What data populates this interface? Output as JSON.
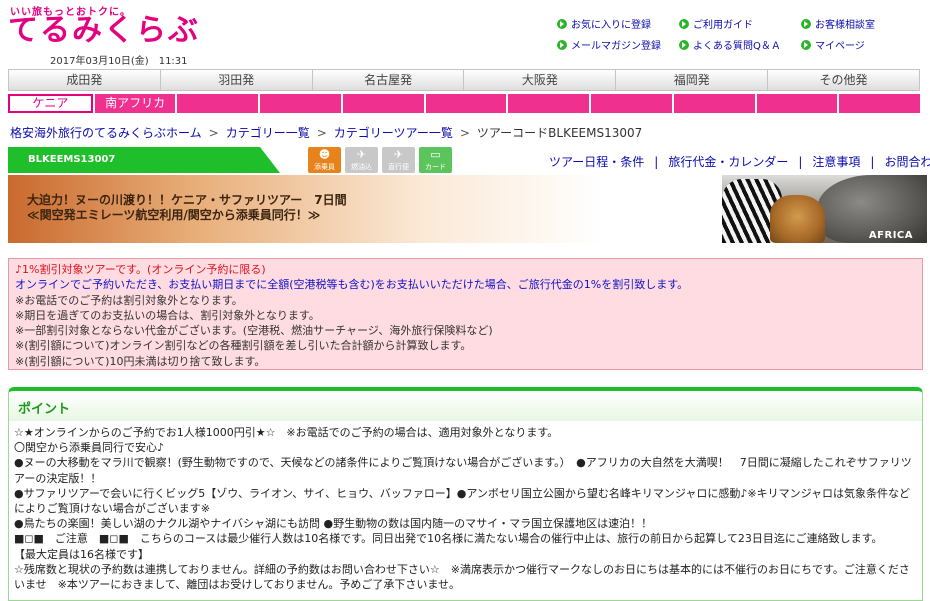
{
  "logo": {
    "tagline": "いい旅もっとおトクに。",
    "name": "てるみくらぶ",
    "datetime": "2017年03月10日(金)　11:31"
  },
  "header_links": [
    {
      "label": "お気に入りに登録"
    },
    {
      "label": "ご利用ガイド"
    },
    {
      "label": "お客様相談室"
    },
    {
      "label": "メールマガジン登録"
    },
    {
      "label": "よくある質問Q＆Ａ"
    },
    {
      "label": "マイページ"
    }
  ],
  "departure_nav": [
    "成田発",
    "羽田発",
    "名古屋発",
    "大阪発",
    "福岡発",
    "その他発"
  ],
  "country_tabs": [
    "ケニア",
    "南アフリカ",
    "",
    "",
    "",
    "",
    "",
    "",
    "",
    "",
    ""
  ],
  "breadcrumb": [
    "格安海外旅行のてるみくらぶホーム",
    "カテゴリー一覧",
    "カテゴリーツアー一覧",
    "ツアーコードBLKEEMS13007"
  ],
  "tour": {
    "code": "BLKEEMS13007",
    "icons": [
      {
        "label": "添乗員",
        "icon": "tour-guide-icon"
      },
      {
        "label": "燃油込",
        "icon": "fuel-included-icon"
      },
      {
        "label": "直行便",
        "icon": "direct-flight-icon"
      },
      {
        "label": "カード",
        "icon": "card-payment-icon"
      }
    ],
    "links": [
      "ツアー日程・条件",
      "旅行代金・カレンダー",
      "注意事項",
      "お問合わせ"
    ],
    "title_line1": "大迫力！ヌーの川渡り！！ケニア・サファリツアー　7日間",
    "title_line2": "≪関空発エミレーツ航空利用/関空から添乗員同行！≫",
    "banner_label": "AFRICA"
  },
  "discount": {
    "line1": "♪1%割引対象ツアーです。(オンライン予約に限る)",
    "line2": "オンラインでご予約いただき、お支払い期日までに全額(空港税等も含む)をお支払いいただけた場合、ご旅行代金の1%を割引致します。",
    "notes": [
      "※お電話でのご予約は割引対象外となります。",
      "※期日を過ぎてのお支払いの場合は、割引対象外となります。",
      "※一部割引対象とならない代金がございます。(空港税、燃油サーチャージ、海外旅行保険料など)",
      "※(割引額について)オンライン割引などの各種割引額を差し引いた合計額から計算致します。",
      "※(割引額について)10円未満は切り捨て致します。"
    ]
  },
  "point": {
    "title": "ポイント",
    "lines": [
      "☆★オンラインからのご予約でお1人様1000円引★☆　※お電話でのご予約の場合は、適用対象外となります。",
      "〇関空から添乗員同行で安心♪",
      "●ヌーの大移動をマラ川で観察！(野生動物ですので、天候などの諸条件によりご覧頂けない場合がございます。）　●アフリカの大自然を大満喫！　7日間に凝縮したこれぞサファリツアーの決定版！！",
      "●サファリツアーで会いに行くビッグ5【ゾウ、ライオン、サイ、ヒョウ、バッファロー】●アンボセリ国立公園から望む名峰キリマンジャロに感動♪※キリマンジャロは気象条件などによりご覧頂けない場合がございます※",
      "●鳥たちの楽園！美しい湖のナクル湖やナイバシャ湖にも訪問 ●野生動物の数は国内随一のマサイ・マラ国立保護地区は速泊！！",
      "■◻■　ご注意　■◻■　こちらのコースは最少催行人数は10名様です。同日出発で10名様に満たない場合の催行中止は、旅行の前日から起算して23日目迄にご連絡致します。",
      "【最大定員は16名様です】",
      "☆残席数と現状の予約数は連携しておりません。詳細の予約数はお問い合わせ下さい☆　※満席表示かつ催行マークなしのお日にちは基本的には不催行のお日にちです。ご注意くださいませ　※本ツアーにおきまして、離団はお受けしておりません。予めご了承下さいませ。"
    ]
  },
  "colors": {
    "brand_pink": "#e4007f",
    "green": "#1fbf2b",
    "link_blue": "#0a0ab0",
    "notice_red": "#e0101a"
  }
}
